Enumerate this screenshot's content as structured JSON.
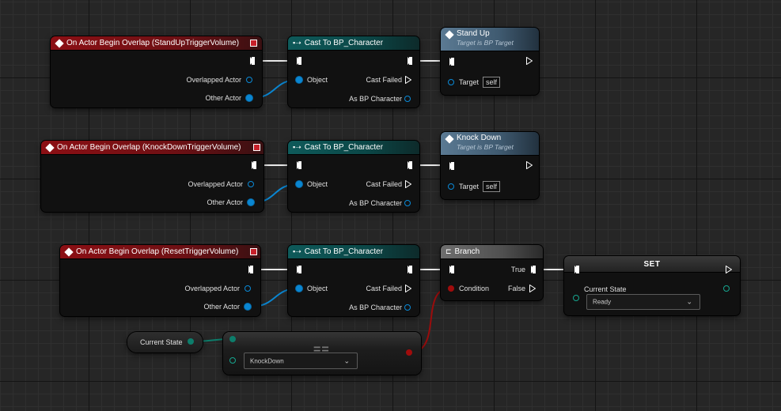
{
  "rows": [
    {
      "event": {
        "title": "On Actor Begin Overlap (StandUpTriggerVolume)",
        "pin_overlapped": "Overlapped Actor",
        "pin_other": "Other Actor"
      },
      "cast": {
        "title": "Cast To BP_Character",
        "pin_object": "Object",
        "pin_failed": "Cast Failed",
        "pin_as": "As BP Character"
      },
      "func": {
        "title": "Stand Up",
        "subtitle": "Target is BP Target",
        "pin_target": "Target",
        "target_value": "self"
      }
    },
    {
      "event": {
        "title": "On Actor Begin Overlap (KnockDownTriggerVolume)",
        "pin_overlapped": "Overlapped Actor",
        "pin_other": "Other Actor"
      },
      "cast": {
        "title": "Cast To BP_Character",
        "pin_object": "Object",
        "pin_failed": "Cast Failed",
        "pin_as": "As BP Character"
      },
      "func": {
        "title": "Knock Down",
        "subtitle": "Target is BP Target",
        "pin_target": "Target",
        "target_value": "self"
      }
    },
    {
      "event": {
        "title": "On Actor Begin Overlap (ResetTriggerVolume)",
        "pin_overlapped": "Overlapped Actor",
        "pin_other": "Other Actor"
      },
      "cast": {
        "title": "Cast To BP_Character",
        "pin_object": "Object",
        "pin_failed": "Cast Failed",
        "pin_as": "As BP Character"
      }
    }
  ],
  "branch": {
    "title": "Branch",
    "pin_condition": "Condition",
    "pin_true": "True",
    "pin_false": "False"
  },
  "set_node": {
    "title": "SET",
    "pin_label": "Current State",
    "value": "Ready"
  },
  "getter": {
    "label": "Current State"
  },
  "equal_node": {
    "symbol": "==",
    "value": "KnockDown"
  },
  "colors": {
    "exec": "#ffffff",
    "object": "#0a86d1",
    "bool": "#a00c0c",
    "byte": "#0d7d6b",
    "event_header": "#8c0f14",
    "cast_header": "#0e5a5a"
  }
}
